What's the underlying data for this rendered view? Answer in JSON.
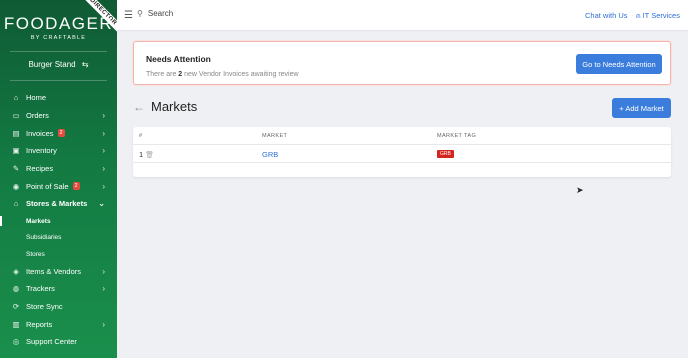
{
  "sidebar": {
    "ribbon": "DIRECTOR",
    "logo_main": "FOODAGER",
    "logo_sub": "BY CRAFTABLE",
    "store_name": "Burger Stand",
    "items": [
      {
        "label": "Home",
        "icon": "home-icon"
      },
      {
        "label": "Orders",
        "icon": "cart-icon"
      },
      {
        "label": "Invoices",
        "icon": "invoice-icon",
        "badge": "2"
      },
      {
        "label": "Inventory",
        "icon": "inventory-icon"
      },
      {
        "label": "Recipes",
        "icon": "recipe-icon"
      },
      {
        "label": "Point of Sale",
        "icon": "pos-icon",
        "badge": "2"
      },
      {
        "label": "Stores & Markets",
        "icon": "store-icon"
      },
      {
        "label": "Items & Vendors",
        "icon": "tag-icon"
      },
      {
        "label": "Trackers",
        "icon": "pin-icon"
      },
      {
        "label": "Store Sync",
        "icon": "sync-icon"
      },
      {
        "label": "Reports",
        "icon": "chart-icon"
      },
      {
        "label": "Support Center",
        "icon": "support-icon"
      }
    ],
    "subitems": [
      "Markets",
      "Subsidiaries",
      "Stores"
    ]
  },
  "topbar": {
    "search_placeholder": "Search",
    "chat_label": "Chat with Us",
    "it_label": "IT Services"
  },
  "alert": {
    "title": "Needs Attention",
    "text_before": "There are ",
    "count": "2",
    "text_after": " new Vendor Invoices awaiting review",
    "button": "Go to Needs Attention"
  },
  "page": {
    "title": "Markets",
    "add_button": "+ Add Market"
  },
  "table": {
    "headers": [
      "#",
      "MARKET",
      "MARKET TAG"
    ],
    "rows": [
      {
        "num": "1",
        "market": "GRB",
        "tag": "GRB"
      }
    ]
  },
  "colors": {
    "accent": "#3b7ddd",
    "sidebar": "#137a42",
    "tag": "#d5241c"
  }
}
